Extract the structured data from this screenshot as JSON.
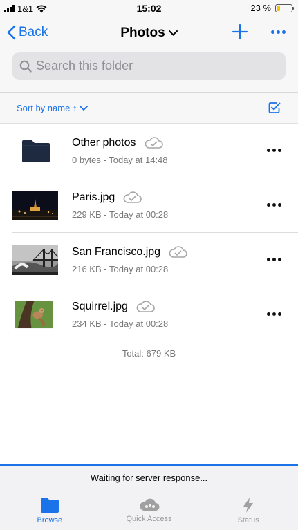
{
  "status_bar": {
    "carrier": "1&1",
    "time": "15:02",
    "battery_text": "23 %",
    "battery_level": 0.23
  },
  "navbar": {
    "back_label": "Back",
    "title": "Photos"
  },
  "search": {
    "placeholder": "Search this folder"
  },
  "sort": {
    "label": "Sort by name ↑"
  },
  "files": [
    {
      "name": "Other photos",
      "meta": "0 bytes - Today at 14:48",
      "type": "folder"
    },
    {
      "name": "Paris.jpg",
      "meta": "229 KB - Today at 00:28",
      "type": "image"
    },
    {
      "name": "San Francisco.jpg",
      "meta": "216 KB - Today at 00:28",
      "type": "image"
    },
    {
      "name": "Squirrel.jpg",
      "meta": "234 KB - Today at 00:28",
      "type": "image"
    }
  ],
  "total": "Total: 679 KB",
  "bottom_status": "Waiting for server response...",
  "tabs": [
    {
      "label": "Browse",
      "icon": "folder-icon",
      "active": true
    },
    {
      "label": "Quick Access",
      "icon": "cloud-icon",
      "active": false
    },
    {
      "label": "Status",
      "icon": "bolt-icon",
      "active": false
    }
  ],
  "colors": {
    "accent": "#1a73e8",
    "folder": "#1e2a3f",
    "battery": "#f5c400"
  }
}
